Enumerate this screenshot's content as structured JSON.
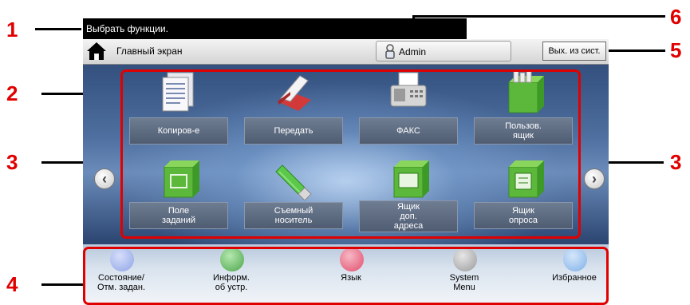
{
  "message_bar": {
    "text": "Выбрать функции."
  },
  "header": {
    "home_label": "Главный экран",
    "user_label": "Admin",
    "logout_label": "Вых. из сист."
  },
  "navigation": {
    "prev_icon": "chevron-left-icon",
    "next_icon": "chevron-right-icon"
  },
  "functions": [
    {
      "label": "Копиров-е",
      "icon": "copy-icon"
    },
    {
      "label": "Передать",
      "icon": "send-icon"
    },
    {
      "label": "ФАКС",
      "icon": "fax-icon"
    },
    {
      "label": "Пользов.\nящик",
      "icon": "custom-box-icon"
    },
    {
      "label": "Поле\nзаданий",
      "icon": "job-box-icon"
    },
    {
      "label": "Съемный\nноситель",
      "icon": "usb-drive-icon"
    },
    {
      "label": "Ящик\nдоп.\nадреса",
      "icon": "sub-address-box-icon"
    },
    {
      "label": "Ящик\nопроса",
      "icon": "polling-box-icon"
    }
  ],
  "task_bar": [
    {
      "label": "Состояние/\nОтм. задан.",
      "icon": "status-icon",
      "color": "#8fa4e6"
    },
    {
      "label": "Информ.\nоб устр.",
      "icon": "device-info-icon",
      "color": "#4aa54a"
    },
    {
      "label": "Язык",
      "icon": "language-icon",
      "color": "#e24d6a"
    },
    {
      "label": "System\nMenu",
      "icon": "system-menu-icon",
      "color": "#9a9a9a"
    },
    {
      "label": "Избранное",
      "icon": "favorites-icon",
      "color": "#7fb0e8"
    }
  ],
  "callouts": [
    "1",
    "2",
    "3",
    "3",
    "4",
    "5",
    "6"
  ],
  "colors": {
    "callout": "#e00000",
    "panel_dark": "#1b2a4a",
    "tile_label": "#5a677d"
  }
}
